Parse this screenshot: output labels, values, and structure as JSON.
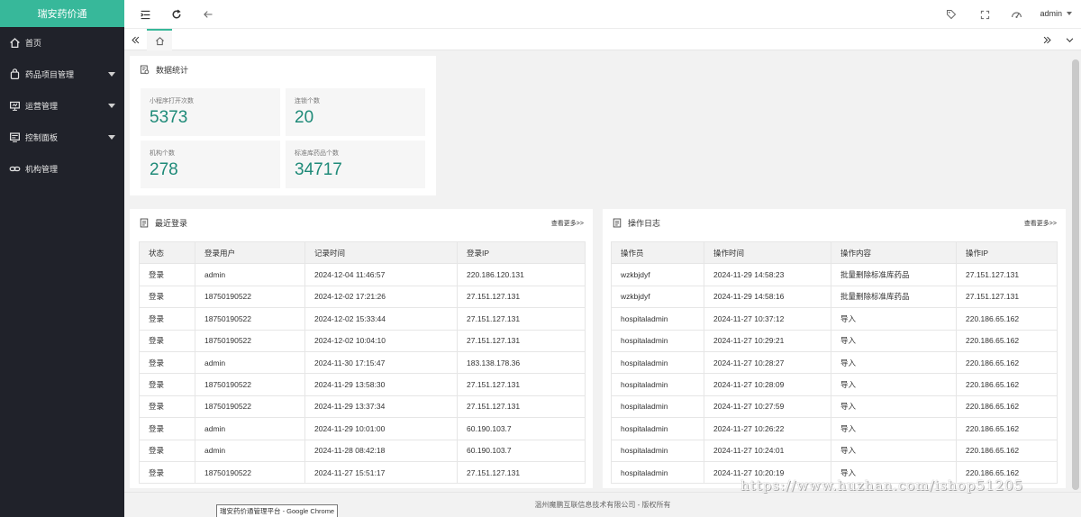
{
  "app": {
    "logo": "瑞安药价通"
  },
  "sidebar": {
    "items": [
      {
        "label": "首页",
        "icon": "home-icon"
      },
      {
        "label": "药品项目管理",
        "icon": "bag-icon"
      },
      {
        "label": "运营管理",
        "icon": "monitor-icon"
      },
      {
        "label": "控制面板",
        "icon": "panel-icon"
      },
      {
        "label": "机构管理",
        "icon": "link-icon"
      }
    ]
  },
  "header": {
    "user": "admin"
  },
  "stats": {
    "title": "数据统计",
    "items": [
      {
        "label": "小程序打开次数",
        "value": "5373"
      },
      {
        "label": "连锁个数",
        "value": "20"
      },
      {
        "label": "机构个数",
        "value": "278"
      },
      {
        "label": "标准库药品个数",
        "value": "34717"
      }
    ]
  },
  "recent_login": {
    "title": "最近登录",
    "more": "查看更多>>",
    "columns": [
      "状态",
      "登录用户",
      "记录时间",
      "登录IP"
    ],
    "rows": [
      [
        "登录",
        "admin",
        "2024-12-04 11:46:57",
        "220.186.120.131"
      ],
      [
        "登录",
        "18750190522",
        "2024-12-02 17:21:26",
        "27.151.127.131"
      ],
      [
        "登录",
        "18750190522",
        "2024-12-02 15:33:44",
        "27.151.127.131"
      ],
      [
        "登录",
        "18750190522",
        "2024-12-02 10:04:10",
        "27.151.127.131"
      ],
      [
        "登录",
        "admin",
        "2024-11-30 17:15:47",
        "183.138.178.36"
      ],
      [
        "登录",
        "18750190522",
        "2024-11-29 13:58:30",
        "27.151.127.131"
      ],
      [
        "登录",
        "18750190522",
        "2024-11-29 13:37:34",
        "27.151.127.131"
      ],
      [
        "登录",
        "admin",
        "2024-11-29 10:01:00",
        "60.190.103.7"
      ],
      [
        "登录",
        "admin",
        "2024-11-28 08:42:18",
        "60.190.103.7"
      ],
      [
        "登录",
        "18750190522",
        "2024-11-27 15:51:17",
        "27.151.127.131"
      ]
    ]
  },
  "op_log": {
    "title": "操作日志",
    "more": "查看更多>>",
    "columns": [
      "操作员",
      "操作时间",
      "操作内容",
      "操作IP"
    ],
    "rows": [
      [
        "wzkbjdyf",
        "2024-11-29 14:58:23",
        "批量删除标准库药品",
        "27.151.127.131"
      ],
      [
        "wzkbjdyf",
        "2024-11-29 14:58:16",
        "批量删除标准库药品",
        "27.151.127.131"
      ],
      [
        "hospitaladmin",
        "2024-11-27 10:37:12",
        "导入",
        "220.186.65.162"
      ],
      [
        "hospitaladmin",
        "2024-11-27 10:29:21",
        "导入",
        "220.186.65.162"
      ],
      [
        "hospitaladmin",
        "2024-11-27 10:28:27",
        "导入",
        "220.186.65.162"
      ],
      [
        "hospitaladmin",
        "2024-11-27 10:28:09",
        "导入",
        "220.186.65.162"
      ],
      [
        "hospitaladmin",
        "2024-11-27 10:27:59",
        "导入",
        "220.186.65.162"
      ],
      [
        "hospitaladmin",
        "2024-11-27 10:26:22",
        "导入",
        "220.186.65.162"
      ],
      [
        "hospitaladmin",
        "2024-11-27 10:24:01",
        "导入",
        "220.186.65.162"
      ],
      [
        "hospitaladmin",
        "2024-11-27 10:20:19",
        "导入",
        "220.186.65.162"
      ]
    ]
  },
  "footer": {
    "text": "温州魔鹏互联信息技术有限公司 - 版权所有"
  },
  "tooltip": {
    "text": "瑞安药价通管理平台 - Google Chrome"
  },
  "watermark": {
    "text": "https://www.huzhan.com/ishop51205"
  },
  "colors": {
    "accent": "#37b89a",
    "stat_value": "#1e8a78",
    "sidebar_bg": "#20222a"
  }
}
